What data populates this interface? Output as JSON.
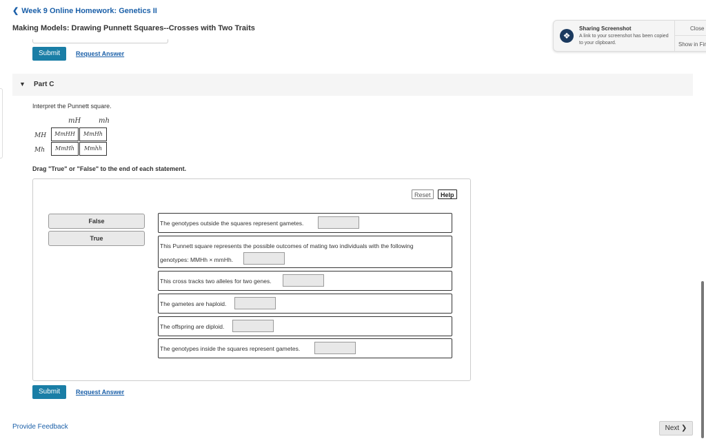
{
  "nav": {
    "back_icon": "chevron-left-icon",
    "back_label": "Week 9 Online Homework: Genetics II"
  },
  "page_title": "Making Models: Drawing Punnett Squares--Crosses with Two Traits",
  "top_actions": {
    "submit_label": "Submit",
    "request_label": "Request Answer"
  },
  "part": {
    "caret_icon": "triangle-down-icon",
    "label": "Part C"
  },
  "instruction": "Interpret the Punnett square.",
  "punnett": {
    "columns": [
      "mH",
      "mh"
    ],
    "rows": [
      {
        "header": "MH",
        "cells": [
          "MmHH",
          "MmHh"
        ]
      },
      {
        "header": "Mh",
        "cells": [
          "MmHh",
          "Mmhh"
        ]
      }
    ]
  },
  "drag_instruction": "Drag \"True\" or \"False\" to the end of each statement.",
  "panel": {
    "reset_label": "Reset",
    "help_label": "Help",
    "tiles": [
      "False",
      "True"
    ],
    "statements": [
      {
        "text": "The genotypes outside the squares represent gametes."
      },
      {
        "text_line1": "This Punnett square represents the possible outcomes of mating two individuals with the following",
        "text_line2": "genotypes: MMHh × mmHh."
      },
      {
        "text": "This cross tracks two alleles for two genes."
      },
      {
        "text": "The gametes are haploid."
      },
      {
        "text": "The offspring are diploid."
      },
      {
        "text": "The genotypes inside the squares represent gametes."
      }
    ]
  },
  "bottom_actions": {
    "submit_label": "Submit",
    "request_label": "Request Answer"
  },
  "notification": {
    "icon": "dropbox-icon",
    "title": "Sharing Screenshot",
    "body": "A link to your screenshot has been copied to your clipboard.",
    "close_label": "Close",
    "show_label": "Show in Finder"
  },
  "footer": {
    "feedback_label": "Provide Feedback",
    "next_label": "Next",
    "next_icon": "chevron-right-icon"
  }
}
